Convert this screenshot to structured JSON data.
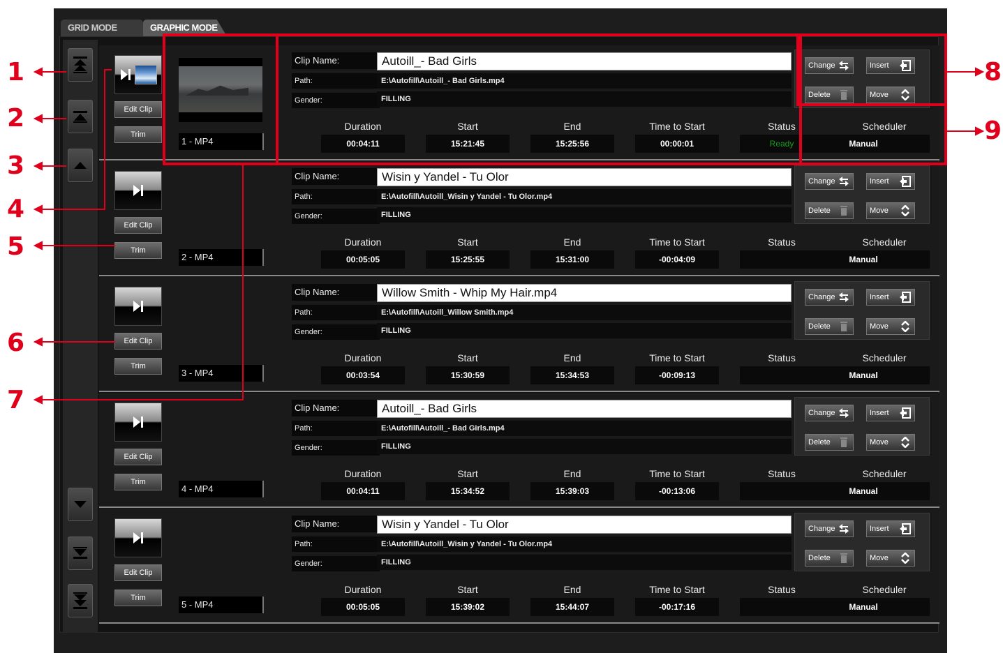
{
  "tabs": [
    {
      "label": "GRID MODE",
      "active": false
    },
    {
      "label": "GRAPHIC MODE",
      "active": true
    }
  ],
  "nav": {
    "top_icon": "skip-to-top-icon",
    "page_up_icon": "page-up-icon",
    "up_icon": "arrow-up-icon",
    "down_icon": "arrow-down-icon",
    "page_down_icon": "page-down-icon",
    "bottom_icon": "skip-to-bottom-icon"
  },
  "labels": {
    "clip_name": "Clip Name:",
    "path": "Path:",
    "gender": "Gender:",
    "duration": "Duration",
    "start": "Start",
    "end": "End",
    "time_to_start": "Time to Start",
    "status": "Status",
    "scheduler": "Scheduler",
    "edit_clip": "Edit Clip",
    "trim": "Trim",
    "change": "Change",
    "insert": "Insert",
    "delete": "Delete",
    "move": "Move"
  },
  "clips": [
    {
      "index": "1 - MP4",
      "name": "Autoill_- Bad Girls",
      "path": "E:\\Autofill\\Autoill_- Bad Girls.mp4",
      "gender": "FILLING",
      "duration": "00:04:11",
      "start": "15:21:45",
      "end": "15:25:56",
      "time_to_start": "00:00:01",
      "status": "Ready",
      "scheduler": "Manual"
    },
    {
      "index": "2 - MP4",
      "name": "Wisin y Yandel - Tu Olor",
      "path": "E:\\Autofill\\Autoill_Wisin y Yandel - Tu Olor.mp4",
      "gender": "FILLING",
      "duration": "00:05:05",
      "start": "15:25:55",
      "end": "15:31:00",
      "time_to_start": "-00:04:09",
      "status": "",
      "scheduler": "Manual"
    },
    {
      "index": "3 - MP4",
      "name": "Willow Smith - Whip My Hair.mp4",
      "path": "E:\\Autofill\\Autoill_Willow Smith.mp4",
      "gender": "FILLING",
      "duration": "00:03:54",
      "start": "15:30:59",
      "end": "15:34:53",
      "time_to_start": "-00:09:13",
      "status": "",
      "scheduler": "Manual"
    },
    {
      "index": "4 - MP4",
      "name": "Autoill_- Bad Girls",
      "path": "E:\\Autofill\\Autoill_- Bad Girls.mp4",
      "gender": "FILLING",
      "duration": "00:04:11",
      "start": "15:34:52",
      "end": "15:39:03",
      "time_to_start": "-00:13:06",
      "status": "",
      "scheduler": "Manual"
    },
    {
      "index": "5 - MP4",
      "name": "Wisin y Yandel - Tu Olor",
      "path": "E:\\Autofill\\Autoill_Wisin y Yandel - Tu Olor.mp4",
      "gender": "FILLING",
      "duration": "00:05:05",
      "start": "15:39:02",
      "end": "15:44:07",
      "time_to_start": "-00:17:16",
      "status": "",
      "scheduler": "Manual"
    }
  ],
  "callouts": [
    "1",
    "2",
    "3",
    "4",
    "5",
    "6",
    "7",
    "8",
    "9"
  ],
  "colors": {
    "annotation": "#e0001c",
    "ready": "#1a9b1a",
    "panel": "#1a1a1a"
  }
}
